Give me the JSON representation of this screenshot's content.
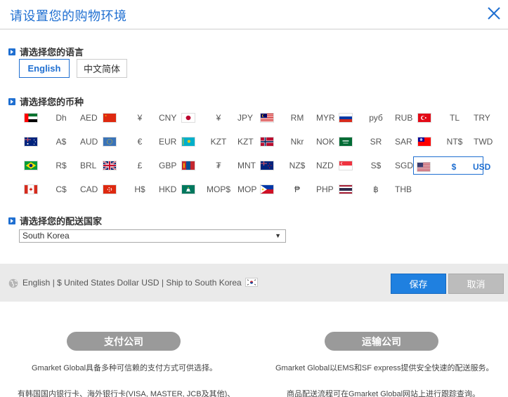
{
  "header": {
    "title": "请设置您的购物环境"
  },
  "language": {
    "label": "请选择您的语言",
    "options": [
      "English",
      "中文简体"
    ],
    "selected": "English"
  },
  "currency": {
    "label": "请选择您的币种",
    "items": [
      {
        "flag": "ae-flag",
        "symbol": "Dh",
        "code": "AED"
      },
      {
        "flag": "cn-flag",
        "symbol": "¥",
        "code": "CNY"
      },
      {
        "flag": "jp-flag",
        "symbol": "¥",
        "code": "JPY"
      },
      {
        "flag": "my-flag",
        "symbol": "RM",
        "code": "MYR"
      },
      {
        "flag": "ru-flag",
        "symbol": "руб",
        "code": "RUB"
      },
      {
        "flag": "tr-flag",
        "symbol": "TL",
        "code": "TRY"
      },
      {
        "flag": "au-flag",
        "symbol": "A$",
        "code": "AUD"
      },
      {
        "flag": "eu-flag",
        "symbol": "€",
        "code": "EUR"
      },
      {
        "flag": "kz-flag",
        "symbol": "KZT",
        "code": "KZT"
      },
      {
        "flag": "no-flag",
        "symbol": "Nkr",
        "code": "NOK"
      },
      {
        "flag": "sa-flag",
        "symbol": "SR",
        "code": "SAR"
      },
      {
        "flag": "tw-flag",
        "symbol": "NT$",
        "code": "TWD"
      },
      {
        "flag": "br-flag",
        "symbol": "R$",
        "code": "BRL"
      },
      {
        "flag": "gb-flag",
        "symbol": "£",
        "code": "GBP"
      },
      {
        "flag": "mn-flag",
        "symbol": "₮",
        "code": "MNT"
      },
      {
        "flag": "nz-flag",
        "symbol": "NZ$",
        "code": "NZD"
      },
      {
        "flag": "sg-flag",
        "symbol": "S$",
        "code": "SGD"
      },
      {
        "flag": "us-flag",
        "symbol": "$",
        "code": "USD"
      },
      {
        "flag": "ca-flag",
        "symbol": "C$",
        "code": "CAD"
      },
      {
        "flag": "hk-flag",
        "symbol": "H$",
        "code": "HKD"
      },
      {
        "flag": "mo-flag",
        "symbol": "MOP$",
        "code": "MOP"
      },
      {
        "flag": "ph-flag",
        "symbol": "₱",
        "code": "PHP"
      },
      {
        "flag": "th-flag",
        "symbol": "฿",
        "code": "THB"
      }
    ],
    "selected": "USD"
  },
  "shipping": {
    "label": "请选择您的配送国家",
    "selected": "South Korea"
  },
  "summary_bar": {
    "text": "English | $ United States Dollar USD | Ship to South Korea",
    "save_label": "保存",
    "cancel_label": "取消"
  },
  "payment": {
    "title": "支付公司",
    "line1": "Gmarket Global具备多种可信赖的支付方式可供选择。",
    "line2": "有韩国国内银行卡、海外银行卡(VISA, MASTER, JCB及其他)、"
  },
  "shipping_company": {
    "title": "运输公司",
    "line1": "Gmarket Global以EMS和SF express提供安全快速的配送服务。",
    "line2": "商品配送流程可在Gmarket Global网站上进行跟踪查询。"
  },
  "colors": {
    "accent": "#1f6fd1",
    "save": "#1f80e0",
    "cancel": "#bcbcbc",
    "pill": "#9a9a9a"
  }
}
